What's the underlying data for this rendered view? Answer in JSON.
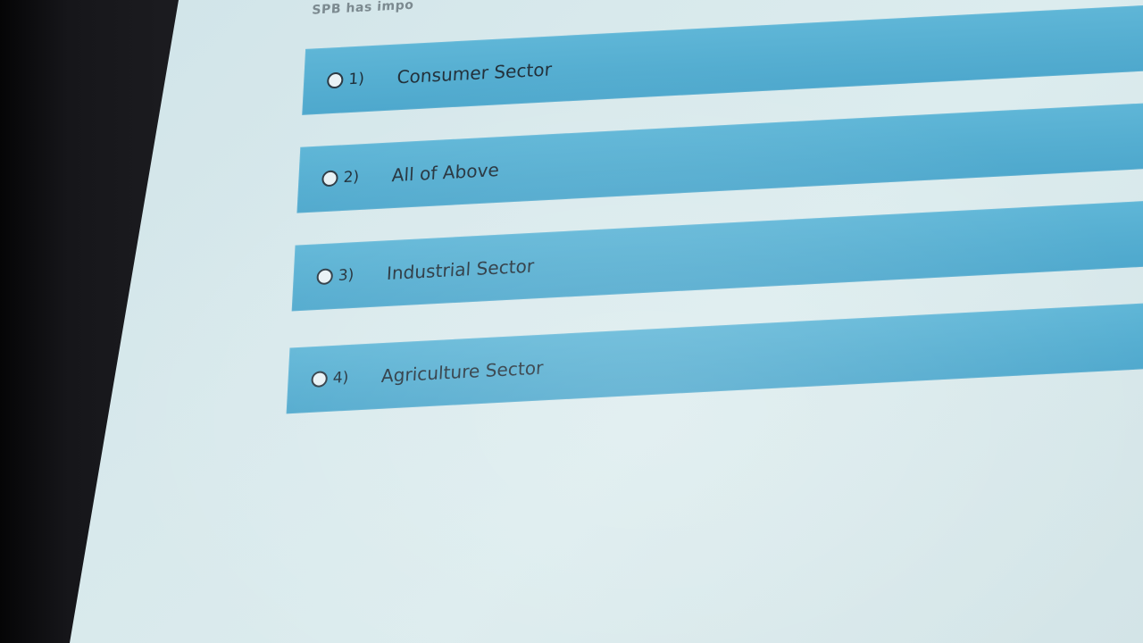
{
  "question": {
    "text": "SPB has impo"
  },
  "options": [
    {
      "number": "1)",
      "label": "Consumer Sector"
    },
    {
      "number": "2)",
      "label": "All of Above"
    },
    {
      "number": "3)",
      "label": "Industrial Sector"
    },
    {
      "number": "4)",
      "label": "Agriculture Sector"
    }
  ],
  "colors": {
    "option_background": "#55aed1",
    "page_background": "#d8e9ec",
    "text": "#23313b"
  }
}
